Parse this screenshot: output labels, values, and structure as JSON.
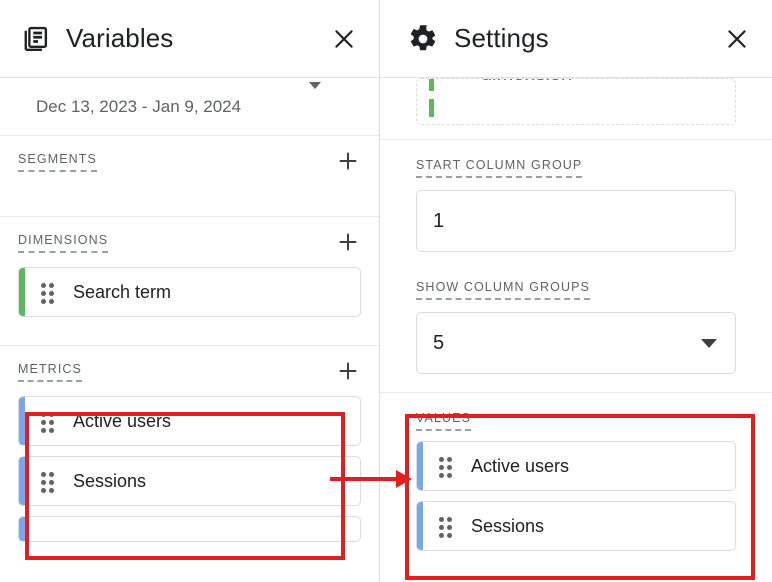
{
  "variables_panel": {
    "header": {
      "icon": "library-books-icon",
      "title": "Variables",
      "close_icon": "close-icon"
    },
    "date_range": {
      "value": "Dec 13, 2023 - Jan 9, 2024",
      "caret_icon": "chevron-down-icon"
    },
    "segments": {
      "label": "SEGMENTS",
      "add_icon": "plus-icon",
      "items": []
    },
    "dimensions": {
      "label": "DIMENSIONS",
      "add_icon": "plus-icon",
      "items": [
        {
          "label": "Search term",
          "accent": "#5cb85c",
          "drag_icon": "drag-handle-icon"
        }
      ]
    },
    "metrics": {
      "label": "METRICS",
      "add_icon": "plus-icon",
      "items": [
        {
          "label": "Active users",
          "accent": "#7aa7ea",
          "drag_icon": "drag-handle-icon"
        },
        {
          "label": "Sessions",
          "accent": "#7aa7ea",
          "drag_icon": "drag-handle-icon"
        },
        {
          "label": "",
          "accent": "#7aa7ea",
          "drag_icon": "drag-handle-icon"
        }
      ]
    }
  },
  "settings_panel": {
    "header": {
      "icon": "gear-icon",
      "title": "Settings",
      "close_icon": "close-icon"
    },
    "dropzone": {
      "text": "dimension",
      "accent": "#5cb85c"
    },
    "start_column_group": {
      "label": "START COLUMN GROUP",
      "value": "1"
    },
    "show_column_groups": {
      "label": "SHOW COLUMN GROUPS",
      "value": "5",
      "caret_icon": "chevron-down-icon"
    },
    "values": {
      "label": "VALUES",
      "items": [
        {
          "label": "Active users",
          "accent": "#7aa7ea",
          "drag_icon": "drag-handle-icon"
        },
        {
          "label": "Sessions",
          "accent": "#7aa7ea",
          "drag_icon": "drag-handle-icon"
        }
      ]
    }
  },
  "annotations": {
    "highlight_color": "#e02020",
    "arrow_icon": "arrow-right-icon",
    "left_highlight_target": "metrics-list",
    "right_highlight_target": "values-list"
  }
}
